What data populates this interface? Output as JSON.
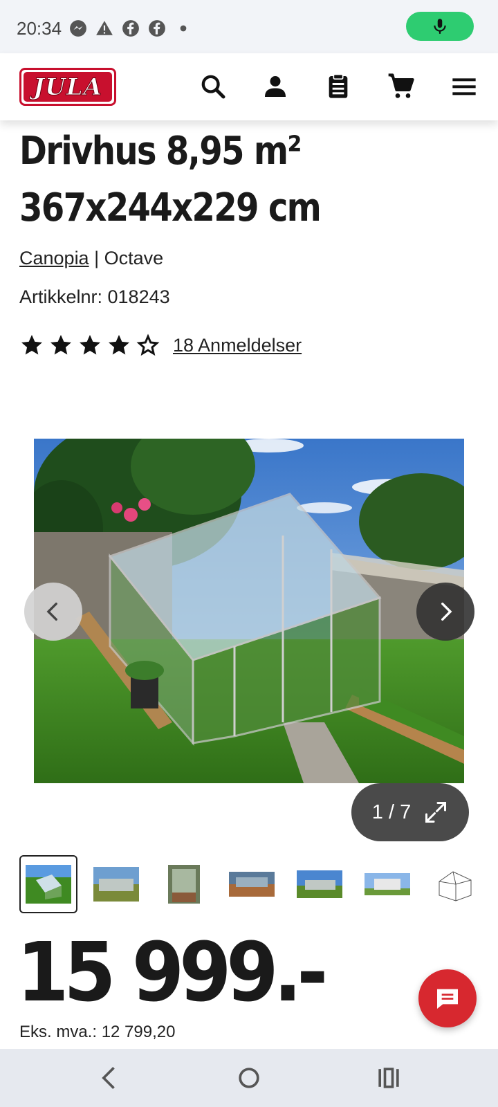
{
  "status_bar": {
    "time": "20:34",
    "icons": [
      "messenger-icon",
      "warning-icon",
      "facebook-icon",
      "facebook-icon",
      "dot-icon"
    ],
    "mic_color": "#2ecc71"
  },
  "header": {
    "logo_text": "JULA",
    "icons": [
      "search-icon",
      "account-icon",
      "list-icon",
      "cart-icon",
      "menu-icon"
    ]
  },
  "product": {
    "title_line1": "Drivhus 8,95 m²",
    "title_line2": "367x244x229 cm",
    "brand": "Canopia",
    "separator": " | ",
    "series": "Octave",
    "sku": "Artikkelnr: 018243",
    "rating": 4,
    "rating_max": 5,
    "reviews": "18 Anmeldelser"
  },
  "gallery": {
    "counter": "1 / 7",
    "thumbnail_count": 7,
    "active_index": 0
  },
  "price": {
    "value": "15 999.-",
    "ex_vat": "Eks. mva.: 12 799,20"
  },
  "colors": {
    "brand_red": "#c8102e",
    "chat_red": "#d7282f",
    "text": "#1a1a1a"
  }
}
